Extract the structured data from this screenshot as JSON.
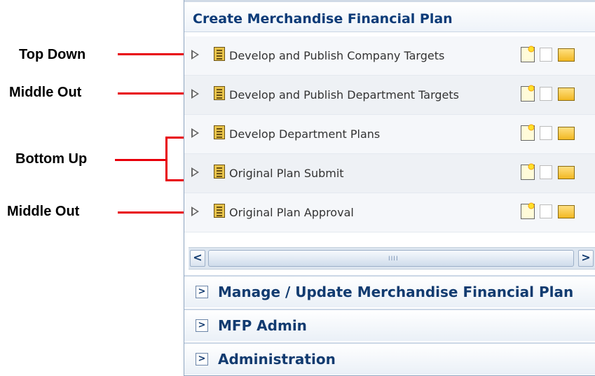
{
  "callouts": {
    "top_down": "Top Down",
    "middle_out_1": "Middle Out",
    "bottom_up": "Bottom Up",
    "middle_out_2": "Middle Out"
  },
  "panel": {
    "title": "Create Merchandise Financial Plan",
    "tasks": [
      {
        "label": "Develop and Publish Company Targets"
      },
      {
        "label": "Develop and Publish Department Targets"
      },
      {
        "label": "Develop Department Plans"
      },
      {
        "label": "Original Plan Submit"
      },
      {
        "label": "Original Plan Approval"
      }
    ],
    "scrollbar": {
      "left_arrow": "<",
      "right_arrow": ">",
      "grip": "IIII"
    },
    "sections": [
      {
        "arrow": ">",
        "title": "Manage / Update Merchandise Financial Plan"
      },
      {
        "arrow": ">",
        "title": "MFP Admin"
      },
      {
        "arrow": ">",
        "title": "Administration"
      }
    ]
  },
  "colors": {
    "leader_line": "#e8000a",
    "title_text": "#0c3b78",
    "section_text": "#123b70"
  },
  "icons": [
    "expand-triangle-icon",
    "task-document-icon",
    "new-document-icon",
    "blank-document-icon",
    "open-folder-icon",
    "chevron-right-icon"
  ]
}
